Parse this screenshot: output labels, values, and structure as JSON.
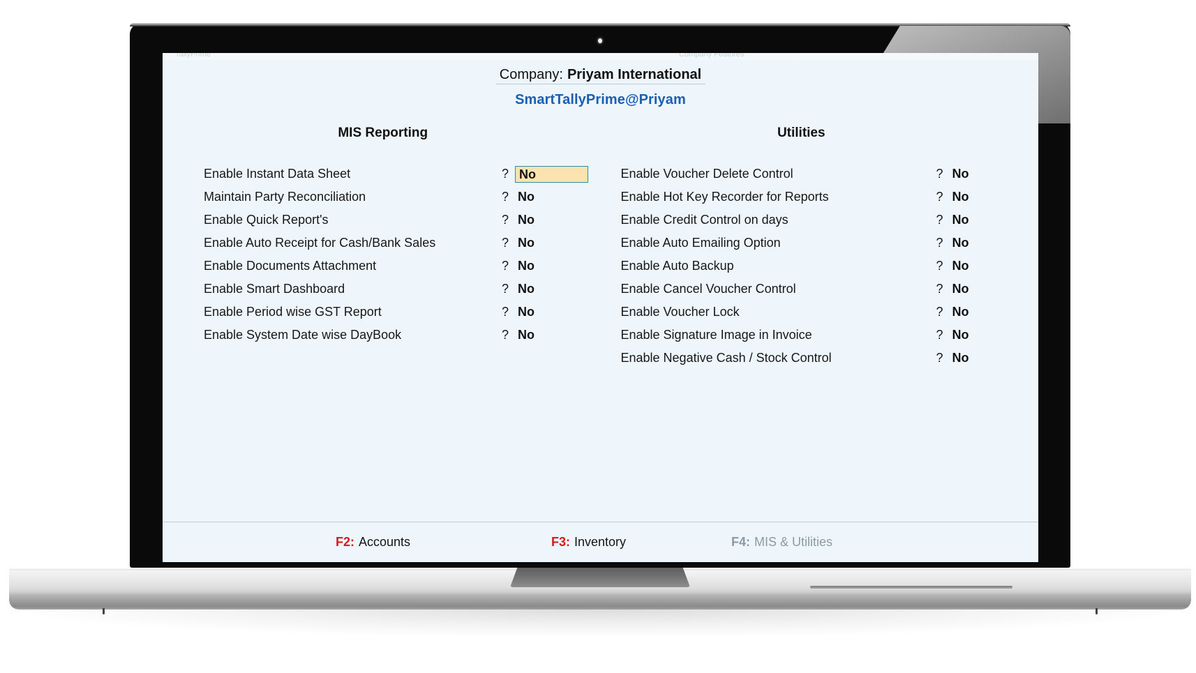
{
  "screen": {
    "background_color": "#eef6fb",
    "clipped_titlebar": {
      "left_ghost": "TallyPrime",
      "right_ghost": "Company Features"
    },
    "company": {
      "label": "Company:",
      "name": "Priyam International"
    },
    "brand": "SmartTallyPrime@Priyam",
    "accent_color": "#1a5fb4"
  },
  "mis": {
    "heading": "MIS Reporting",
    "options": [
      {
        "label": "Enable Instant Data Sheet",
        "prompt": "?",
        "value": "No",
        "selected": true
      },
      {
        "label": "Maintain Party Reconciliation",
        "prompt": "?",
        "value": "No",
        "selected": false
      },
      {
        "label": "Enable Quick Report's",
        "prompt": "?",
        "value": "No",
        "selected": false
      },
      {
        "label": "Enable Auto Receipt for Cash/Bank Sales",
        "prompt": "?",
        "value": "No",
        "selected": false
      },
      {
        "label": "Enable Documents Attachment",
        "prompt": "?",
        "value": "No",
        "selected": false
      },
      {
        "label": "Enable Smart Dashboard",
        "prompt": "?",
        "value": "No",
        "selected": false
      },
      {
        "label": "Enable Period wise GST Report",
        "prompt": "?",
        "value": "No",
        "selected": false
      },
      {
        "label": "Enable System Date wise DayBook",
        "prompt": "?",
        "value": "No",
        "selected": false
      }
    ]
  },
  "utilities": {
    "heading": "Utilities",
    "options": [
      {
        "label": "Enable Voucher Delete Control",
        "prompt": "?",
        "value": "No",
        "selected": false
      },
      {
        "label": "Enable Hot Key Recorder for Reports",
        "prompt": "?",
        "value": "No",
        "selected": false
      },
      {
        "label": "Enable Credit Control on days",
        "prompt": "?",
        "value": "No",
        "selected": false
      },
      {
        "label": "Enable Auto Emailing Option",
        "prompt": "?",
        "value": "No",
        "selected": false
      },
      {
        "label": "Enable Auto Backup",
        "prompt": "?",
        "value": "No",
        "selected": false
      },
      {
        "label": "Enable Cancel Voucher Control",
        "prompt": "?",
        "value": "No",
        "selected": false
      },
      {
        "label": "Enable Voucher Lock",
        "prompt": "?",
        "value": "No",
        "selected": false
      },
      {
        "label": "Enable Signature Image in Invoice",
        "prompt": "?",
        "value": "No",
        "selected": false
      },
      {
        "label": "Enable Negative Cash / Stock Control",
        "prompt": "?",
        "value": "No",
        "selected": false
      }
    ]
  },
  "footer": {
    "keys": [
      {
        "key": "F2:",
        "label": "Accounts",
        "state": "active"
      },
      {
        "key": "F3:",
        "label": "Inventory",
        "state": "active"
      },
      {
        "key": "F4:",
        "label": "MIS & Utilities",
        "state": "disabled"
      }
    ],
    "active_key_color": "#d91b1b",
    "disabled_color": "#8d9aa3"
  },
  "field_highlight": {
    "fill_color": "#fbe3b0",
    "border_color": "#2d8fa8"
  }
}
